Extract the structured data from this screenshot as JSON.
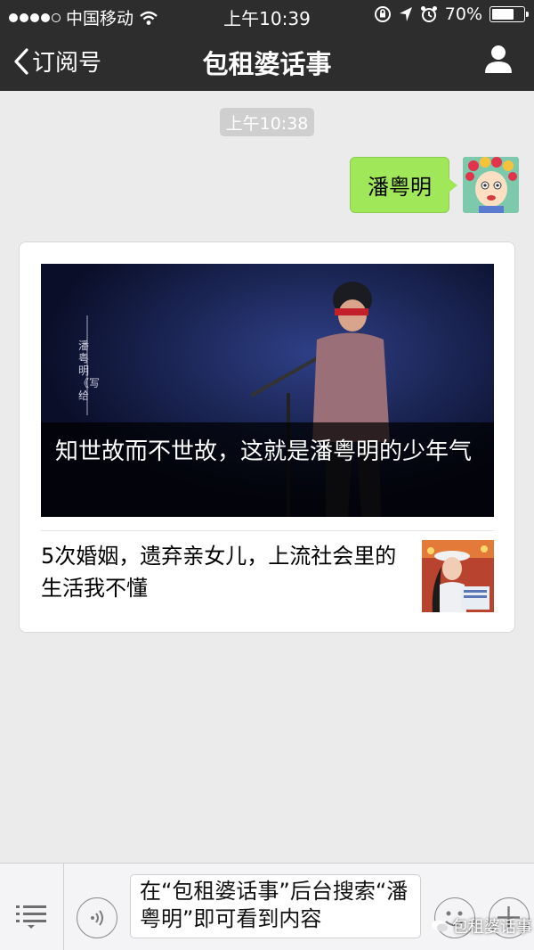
{
  "status_bar": {
    "carrier": "中国移动",
    "time": "上午10:39",
    "battery": "70%",
    "battery_level": 0.7,
    "signal_bars_filled": 4,
    "signal_bars_total": 5,
    "icons": [
      "signal-dots-icon",
      "wifi-icon",
      "orientation-lock-icon",
      "location-arrow-icon",
      "alarm-icon",
      "battery-icon"
    ]
  },
  "nav": {
    "back_label": "订阅号",
    "title": "包租婆话事",
    "icons": [
      "chevron-left-icon",
      "user-profile-icon"
    ]
  },
  "chat": {
    "timestamp": "上午10:38",
    "sent_message": "潘粤明",
    "article": {
      "cover_caption": "知世故而不世故，这就是潘粤明的少年气",
      "cover_side_text": "潘粤明《写给",
      "second_title": "5次婚姻，遗弃亲女儿，上流社会里的生活我不懂"
    }
  },
  "bottom_bar": {
    "input_text": "在“包租婆话事”后台搜索“潘粤明”即可看到内容",
    "watermark": "包租婆话事",
    "icons": [
      "menu-list-icon",
      "voice-icon",
      "emoji-icon",
      "plus-icon"
    ]
  },
  "colors": {
    "bar_bg": "#2d2d2d",
    "chat_bg": "#ebebeb",
    "sent_bubble": "#a0e75a",
    "timestamp_bg": "#cfcfcf"
  }
}
